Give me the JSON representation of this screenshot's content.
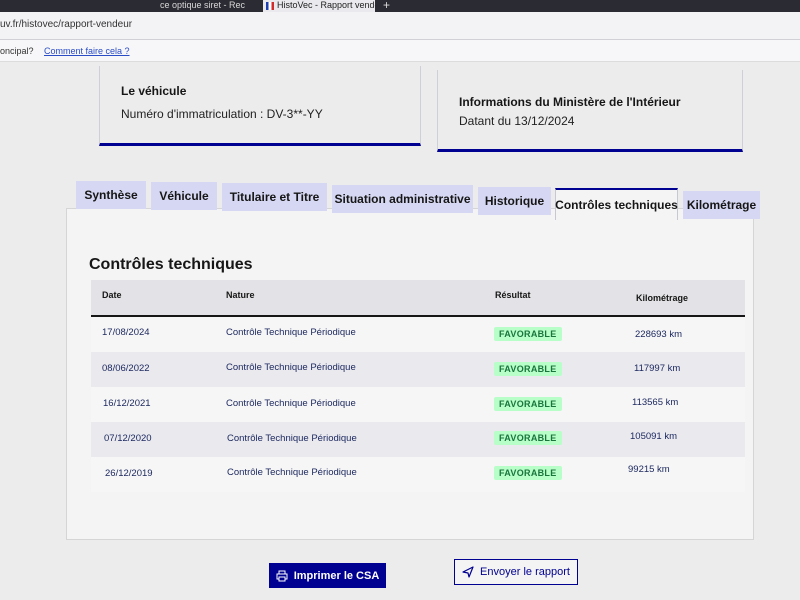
{
  "browser": {
    "tab_left_label": "ce optique siret - Rec",
    "tab_active_label": "HistoVec - Rapport vende",
    "new_tab_label": "+",
    "url": "uv.fr/histovec/rapport-vendeur",
    "bookmark_principal": "oncipal?",
    "bookmark_link": "Comment faire cela ?"
  },
  "vehicle": {
    "title": "Le véhicule",
    "plate_label": "Numéro d'immatriculation : DV-3**-YY"
  },
  "ministry": {
    "title": "Informations du Ministère de l'Intérieur",
    "date_label": "Datant du 13/12/2024"
  },
  "tabs": [
    {
      "label": "Synthèse"
    },
    {
      "label": "Véhicule"
    },
    {
      "label": "Titulaire et Titre"
    },
    {
      "label": "Situation administrative"
    },
    {
      "label": "Historique"
    },
    {
      "label": "Contrôles techniques"
    },
    {
      "label": "Kilométrage"
    }
  ],
  "active_tab": "Contrôles techniques",
  "section_title": "Contrôles techniques",
  "table": {
    "headers": [
      "Date",
      "Nature",
      "Résultat",
      "Kilométrage"
    ],
    "rows": [
      {
        "date": "17/08/2024",
        "nature": "Contrôle Technique Périodique",
        "result": "FAVORABLE",
        "km": "228693 km"
      },
      {
        "date": "08/06/2022",
        "nature": "Contrôle Technique Périodique",
        "result": "FAVORABLE",
        "km": "117997 km"
      },
      {
        "date": "16/12/2021",
        "nature": "Contrôle Technique Périodique",
        "result": "FAVORABLE",
        "km": "113565 km"
      },
      {
        "date": "07/12/2020",
        "nature": "Contrôle Technique Périodique",
        "result": "FAVORABLE",
        "km": "105091 km"
      },
      {
        "date": "26/12/2019",
        "nature": "Contrôle Technique Périodique",
        "result": "FAVORABLE",
        "km": "99215 km"
      }
    ]
  },
  "actions": {
    "print_label": "Imprimer le CSA",
    "send_label": "Envoyer le rapport"
  },
  "colors": {
    "primary": "#000091",
    "tab_bg": "#d6d8f3",
    "badge_bg": "#b8fec9",
    "badge_text": "#18753c"
  },
  "icons": {
    "print": "printer-icon",
    "send": "send-icon"
  }
}
